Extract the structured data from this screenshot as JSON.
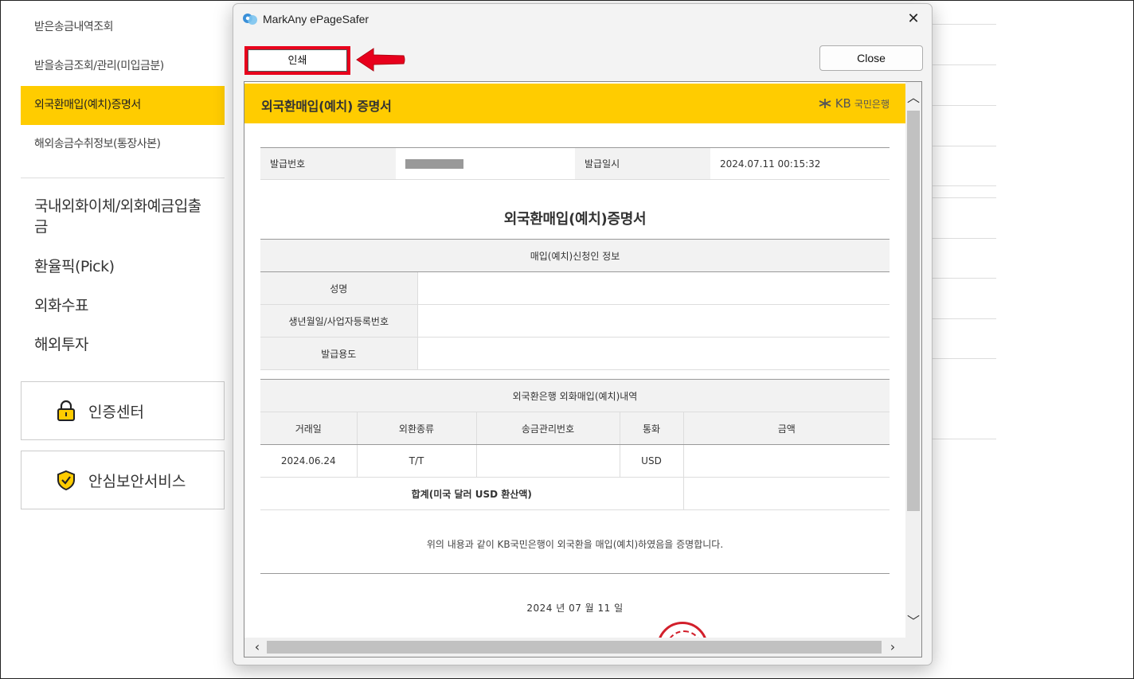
{
  "sidebar": {
    "sub_items": [
      {
        "label": "받은송금내역조회"
      },
      {
        "label": "받을송금조회/관리(미입금분)"
      },
      {
        "label": "외국환매입(예치)증명서"
      },
      {
        "label": "해외송금수취정보(통장사본)"
      }
    ],
    "main_items": [
      {
        "label": "국내외화이체/외화예금입출금"
      },
      {
        "label": "환율픽(Pick)"
      },
      {
        "label": "외화수표"
      },
      {
        "label": "해외투자"
      }
    ],
    "cards": {
      "cert_center": "인증센터",
      "security_service": "안심보안서비스"
    },
    "accent_color": "#ffcc00"
  },
  "dialog": {
    "title": "MarkAny ePageSafer",
    "print_label": "인쇄",
    "close_label": "Close",
    "close_icon": "✕",
    "highlight_color": "#e8001c"
  },
  "document": {
    "header_title": "외국환매입(예치) 증명서",
    "bank_logo": "KB",
    "bank_name": "국민은행",
    "meta": {
      "issue_no_label": "발급번호",
      "issue_date_label": "발급일시",
      "issue_date": "2024.07.11 00:15:32"
    },
    "cert_title": "외국환매입(예치)증명서",
    "applicant": {
      "section_title": "매입(예치)신청인 정보",
      "rows": [
        {
          "label": "성명",
          "value": ""
        },
        {
          "label": "생년월일/사업자등록번호",
          "value": ""
        },
        {
          "label": "발급용도",
          "value": ""
        }
      ]
    },
    "transactions": {
      "section_title": "외국환은행 외화매입(예치)내역",
      "columns": [
        "거래일",
        "외환종류",
        "송금관리번호",
        "통화",
        "금액"
      ],
      "rows": [
        {
          "date": "2024.06.24",
          "type": "T/T",
          "ref": "",
          "currency": "USD",
          "amount": ""
        }
      ],
      "total_label": "합계(미국 달러 USD 환산액)",
      "total_value": ""
    },
    "statement": "위의 내용과 같이 KB국민은행이 외국환을 매입(예치)하였음을 증명합니다.",
    "date_line": "2024 년 07 월 11 일"
  }
}
